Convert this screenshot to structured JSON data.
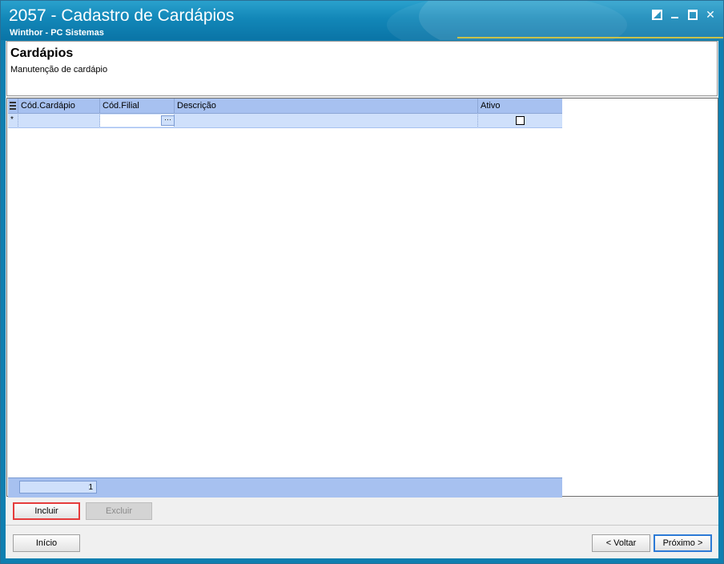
{
  "window": {
    "title": "2057 - Cadastro de Cardápios",
    "subtitle": "Winthor - PC Sistemas"
  },
  "header": {
    "title": "Cardápios",
    "subtitle": "Manutenção de cardápio"
  },
  "grid": {
    "columns": [
      "Cód.Cardápio",
      "Cód.Filial",
      "Descrição",
      "Ativo"
    ],
    "new_row_marker": "*",
    "ellipsis": "···",
    "footer_count": "1"
  },
  "actions": {
    "incluir": "Incluir",
    "excluir": "Excluir"
  },
  "navigation": {
    "inicio": "Início",
    "voltar": "< Voltar",
    "proximo": "Próximo >"
  },
  "colors": {
    "titlebar": "#1287b8",
    "grid_header": "#a7c1f0",
    "grid_row": "#cfe0fb",
    "highlight_border": "#e53b3b",
    "default_button_border": "#2c7ad6"
  }
}
